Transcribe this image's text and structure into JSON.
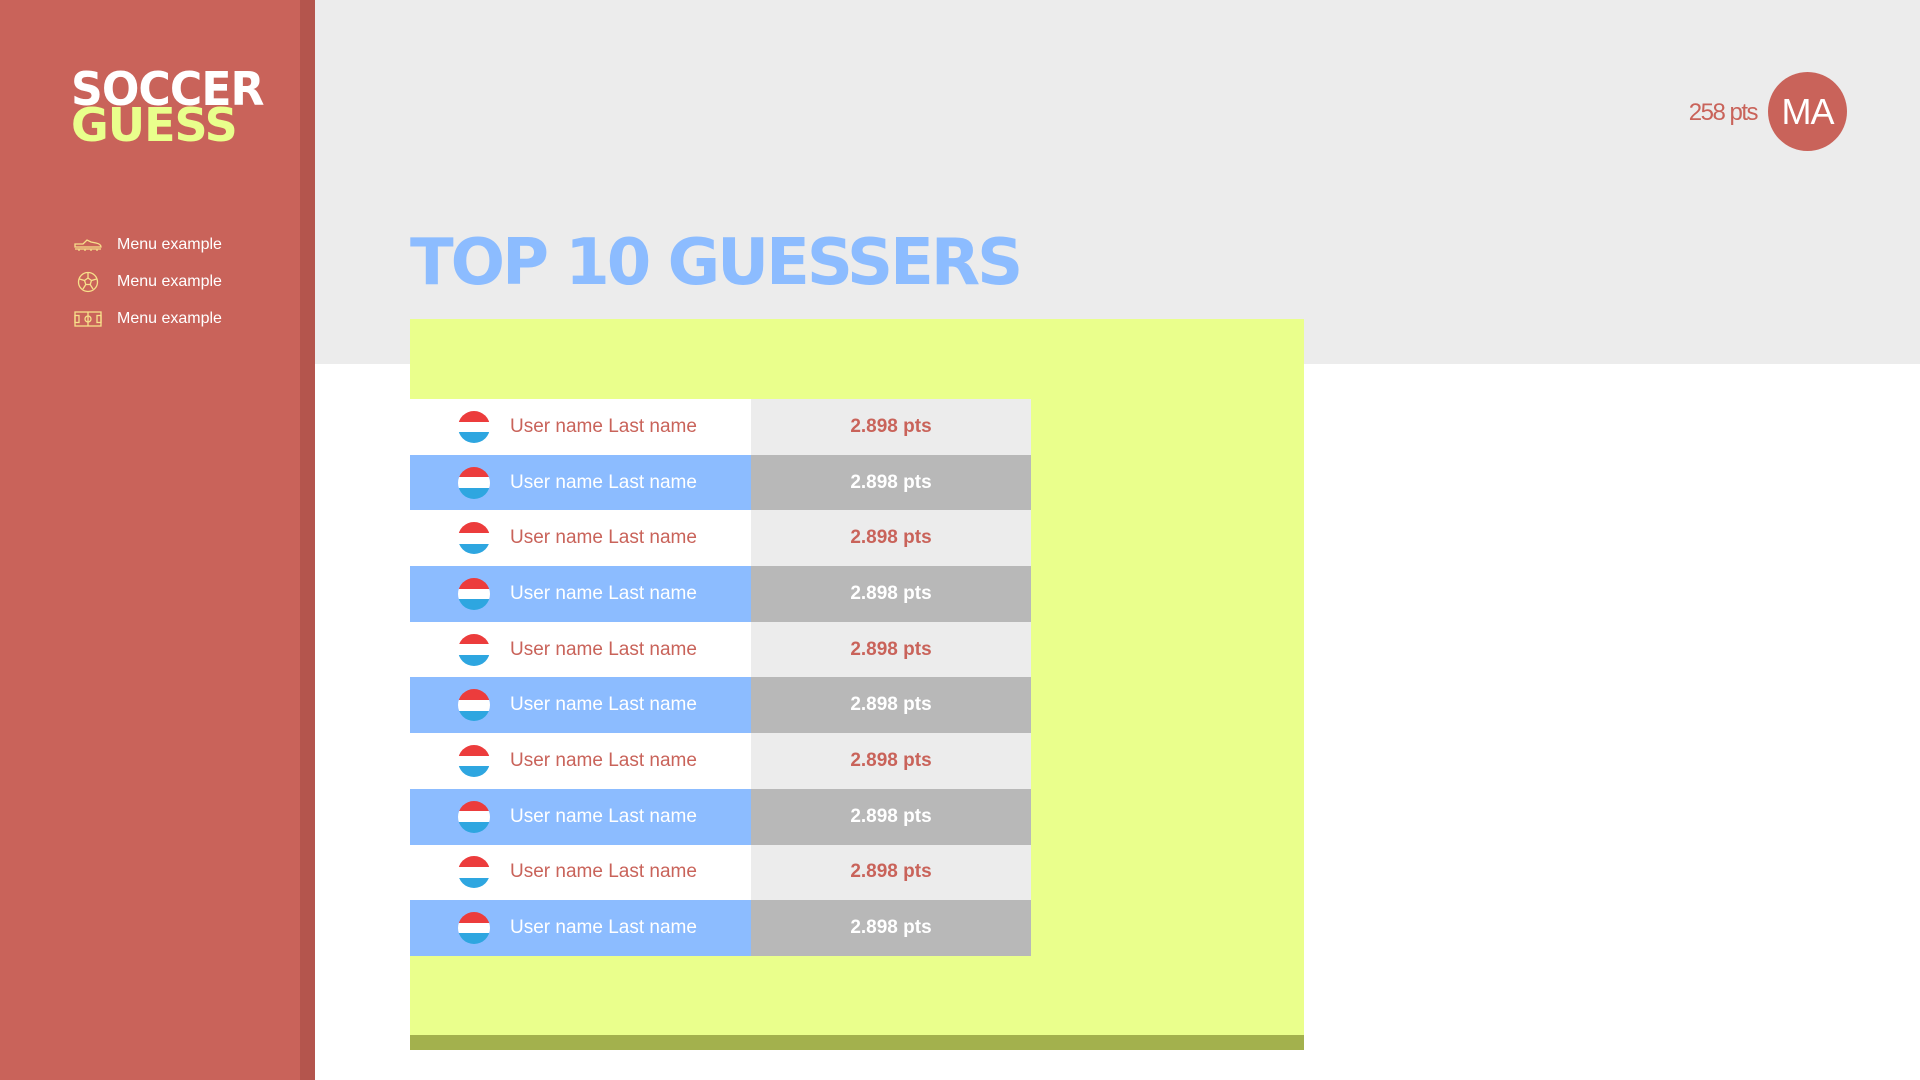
{
  "app": {
    "logo_line1": "SOCCER",
    "logo_line2": "GUESS"
  },
  "sidebar": {
    "items": [
      {
        "label": "Menu example",
        "icon": "cleat-icon"
      },
      {
        "label": "Menu example",
        "icon": "soccer-ball-icon"
      },
      {
        "label": "Menu example",
        "icon": "soccer-field-icon"
      }
    ]
  },
  "user": {
    "points": "258 pts",
    "initials": "MA"
  },
  "page": {
    "title": "TOP 10 GUESSERS"
  },
  "leaderboard": {
    "rows": [
      {
        "name": "User name Last name",
        "points": "2.898 pts",
        "flag": "luxembourg-flag-icon"
      },
      {
        "name": "User name Last name",
        "points": "2.898 pts",
        "flag": "luxembourg-flag-icon"
      },
      {
        "name": "User name Last name",
        "points": "2.898 pts",
        "flag": "luxembourg-flag-icon"
      },
      {
        "name": "User name Last name",
        "points": "2.898 pts",
        "flag": "luxembourg-flag-icon"
      },
      {
        "name": "User name Last name",
        "points": "2.898 pts",
        "flag": "luxembourg-flag-icon"
      },
      {
        "name": "User name Last name",
        "points": "2.898 pts",
        "flag": "luxembourg-flag-icon"
      },
      {
        "name": "User name Last name",
        "points": "2.898 pts",
        "flag": "luxembourg-flag-icon"
      },
      {
        "name": "User name Last name",
        "points": "2.898 pts",
        "flag": "luxembourg-flag-icon"
      },
      {
        "name": "User name Last name",
        "points": "2.898 pts",
        "flag": "luxembourg-flag-icon"
      },
      {
        "name": "User name Last name",
        "points": "2.898 pts",
        "flag": "luxembourg-flag-icon"
      }
    ]
  },
  "colors": {
    "sidebar": "#c9635a",
    "accent_blue": "#8cbcff",
    "accent_lime": "#eaff8c",
    "text_red": "#c9635a"
  }
}
